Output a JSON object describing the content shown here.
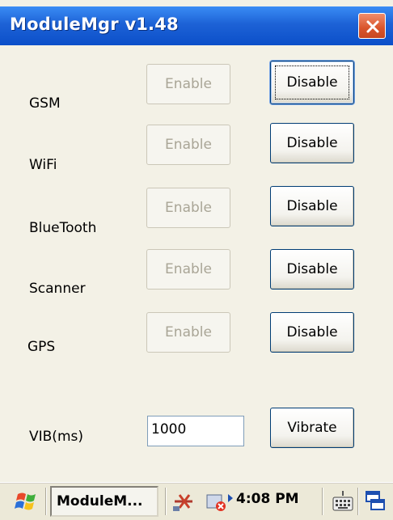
{
  "window": {
    "title": "ModuleMgr v1.48",
    "close_icon": "close-icon"
  },
  "modules": [
    {
      "label": "GSM",
      "enable_label": "Enable",
      "disable_label": "Disable"
    },
    {
      "label": "WiFi",
      "enable_label": "Enable",
      "disable_label": "Disable"
    },
    {
      "label": "BlueTooth",
      "enable_label": "Enable",
      "disable_label": "Disable"
    },
    {
      "label": "Scanner",
      "enable_label": "Enable",
      "disable_label": "Disable"
    },
    {
      "label": "GPS",
      "enable_label": "Enable",
      "disable_label": "Disable"
    }
  ],
  "vib": {
    "label": "VIB(ms)",
    "value": "1000",
    "button_label": "Vibrate"
  },
  "taskbar": {
    "app_label": "ModuleM...",
    "time": "4:08 PM",
    "icons": [
      "start-flag-icon",
      "network-icon",
      "volume-muted-icon",
      "tray-arrow-icon",
      "keyboard-icon",
      "windows-switch-icon"
    ]
  },
  "colors": {
    "title_bar": "#1d62d6",
    "close_button": "#d9542b",
    "background": "#f3f1e6",
    "button_border": "#003c74"
  }
}
